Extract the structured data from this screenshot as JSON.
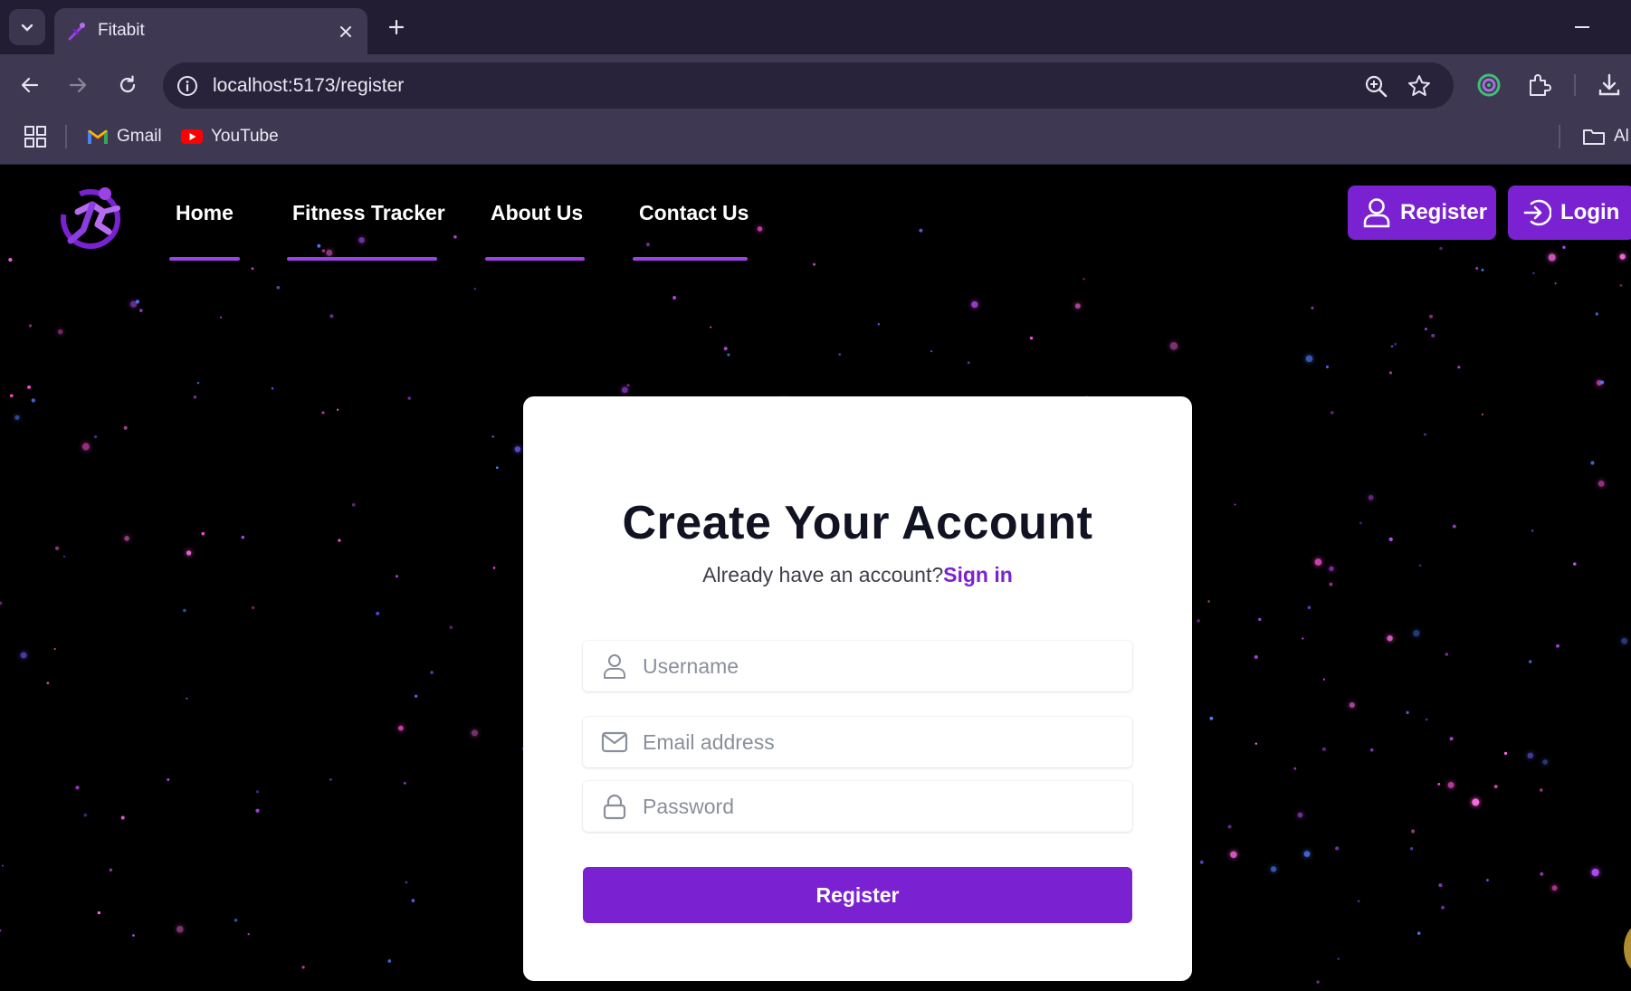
{
  "browser": {
    "tab_title": "Fitabit",
    "url": "localhost:5173/register",
    "bookmarks": [
      {
        "label": "Gmail",
        "icon": "gmail-icon"
      },
      {
        "label": "YouTube",
        "icon": "youtube-icon"
      }
    ],
    "all_bookmarks_label": "Al"
  },
  "nav": {
    "links": [
      "Home",
      "Fitness Tracker",
      "About Us",
      "Contact Us"
    ],
    "register_label": "Register",
    "login_label": "Login"
  },
  "form": {
    "title": "Create Your Account",
    "subtitle": "Already have an account?",
    "signin_label": "Sign in",
    "username_placeholder": "Username",
    "email_placeholder": "Email address",
    "password_placeholder": "Password",
    "submit_label": "Register"
  },
  "colors": {
    "accent": "#7a22d1",
    "nav_underline": "#9b42e6",
    "chrome_dark": "#221d33",
    "chrome_toolbar": "#3e3852"
  }
}
